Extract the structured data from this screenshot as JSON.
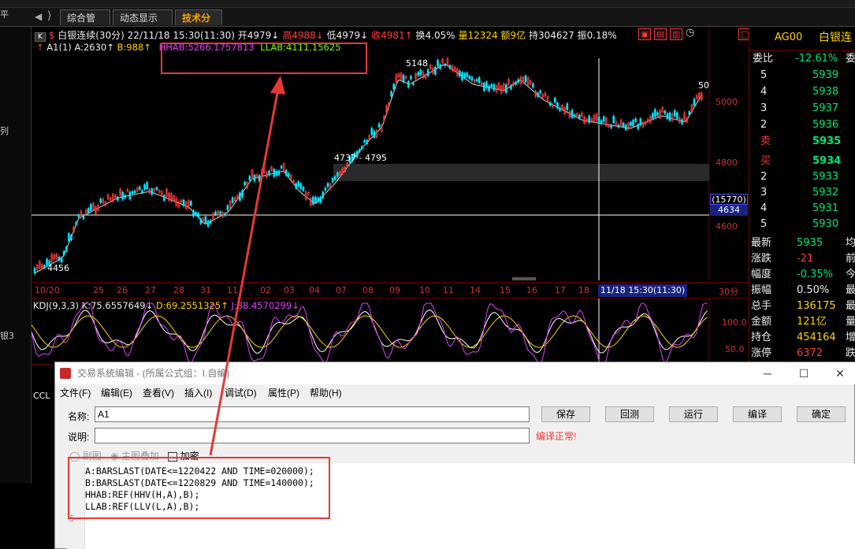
{
  "tabs": [
    {
      "label": "综合管理"
    },
    {
      "label": "动态显示牌"
    },
    {
      "label": "技术分析"
    }
  ],
  "left_strip": {
    "label1": "平",
    "label2": "列",
    "label3": "银3"
  },
  "chart": {
    "header": {
      "symbol": "白银连续(30分)",
      "datetime": "22/11/18 15:30(11:30)",
      "open": "开4979↓",
      "high": "高4988↓",
      "low": "低4979↓",
      "close": "收4981↑",
      "turnover": "换4.05%",
      "volume": "量12324",
      "amount": "额9亿",
      "hold": "持304627",
      "amplitude": "振0.18%"
    },
    "indicator_line": {
      "name": "A1(1)",
      "a": "A:2630↑",
      "b": "B:988↑",
      "hhab": "HHAB:5266.1757813",
      "llab": "LLAB:4111.15625"
    },
    "labels": {
      "peak": "5148",
      "range": "4737 - 4795",
      "low": "4456",
      "last": "50",
      "crosshair_vol": "(15770)",
      "crosshair_price": "4634"
    },
    "price_axis": [
      "5000",
      "4800",
      "4600"
    ],
    "dates": [
      "10/20",
      "25",
      "26",
      "27",
      "28",
      "31",
      "11",
      "02",
      "03",
      "04",
      "07",
      "08",
      "09",
      "10",
      "11",
      "14",
      "15",
      "16",
      "17",
      "18"
    ],
    "date_highlight": "11/18 15:30(11:30)",
    "period": "30分"
  },
  "kdj": {
    "name": "KDJ(9,3,3)",
    "k": "K:75.6557649↓",
    "d": "D:69.2551325↑",
    "j": "J:88.4570299↓",
    "axis": [
      "100.0",
      "50.0"
    ]
  },
  "ccl_label": "CCL",
  "quote": {
    "code": "AG00",
    "name": "白银连",
    "weibi_label": "委比",
    "weibi_value": "-12.61%",
    "weicha_label": "委",
    "sell": [
      {
        "level": "5",
        "price": "5939"
      },
      {
        "level": "4",
        "price": "5938"
      },
      {
        "level": "3",
        "price": "5937"
      },
      {
        "level": "2",
        "price": "5936"
      },
      {
        "level": "卖",
        "price": "5935"
      }
    ],
    "buy": [
      {
        "level": "买",
        "price": "5934"
      },
      {
        "level": "2",
        "price": "5933"
      },
      {
        "level": "3",
        "price": "5932"
      },
      {
        "level": "4",
        "price": "5931"
      },
      {
        "level": "5",
        "price": "5930"
      }
    ],
    "stats": [
      {
        "label": "最新",
        "value": "5935",
        "extra": "均"
      },
      {
        "label": "涨跌",
        "value": "-21",
        "extra": "前"
      },
      {
        "label": "幅度",
        "value": "-0.35%",
        "extra": "今"
      },
      {
        "label": "振幅",
        "value": "0.50%",
        "extra": "最"
      },
      {
        "label": "总手",
        "value": "136175",
        "extra": "最"
      },
      {
        "label": "金额",
        "value": "121亿",
        "extra": "量"
      },
      {
        "label": "持仓",
        "value": "454164",
        "extra": "增"
      },
      {
        "label": "涨停",
        "value": "6372",
        "extra": "跌"
      }
    ]
  },
  "editor": {
    "title": "交易系统编辑 - (所属公式组：I.自编)",
    "menus": [
      "文件(F)",
      "编辑(E)",
      "查看(V)",
      "插入(I)",
      "调试(D)",
      "属性(P)",
      "帮助(H)"
    ],
    "name_label": "名称:",
    "name_value": "A1",
    "desc_label": "说明:",
    "desc_value": "",
    "status": "编译正常!",
    "buttons": {
      "save": "保存",
      "backtest": "回测",
      "run": "运行",
      "compile": "编译",
      "ok": "确定"
    },
    "options": {
      "sub": "副图",
      "main": "主图叠加",
      "encrypt": "加密"
    },
    "code_lines": [
      "A:BARSLAST(DATE<=1220422 AND TIME=020000);",
      "B:BARSLAST(DATE<=1220829 AND TIME=140000);",
      "HHAB:REF(HHV(H,A),B);",
      "LLAB:REF(LLV(L,A),B);"
    ],
    "gutter_mark": "5"
  },
  "colors": {
    "accent": "#ffa500",
    "up": "#ff3b3b",
    "down": "#00e676",
    "annotation": "#e53935"
  }
}
